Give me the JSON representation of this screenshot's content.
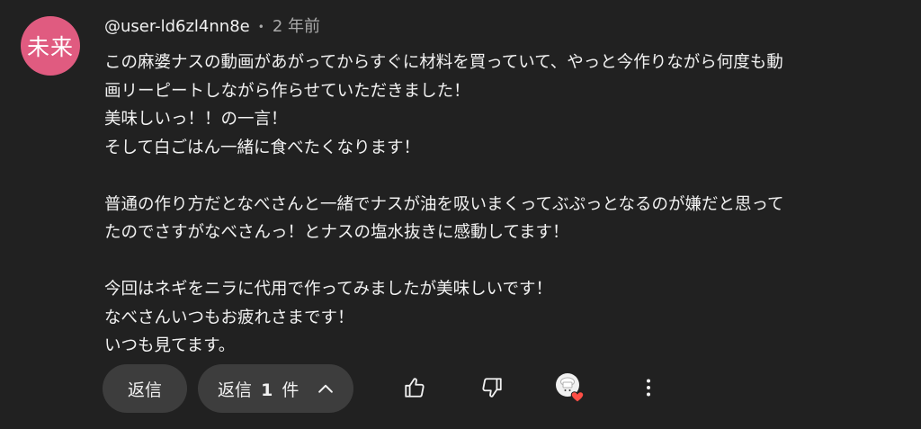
{
  "comment": {
    "avatar_text": "未来",
    "avatar_color": "#e05b80",
    "author": "@user-ld6zl4nn8e",
    "separator": "•",
    "time": "2 年前",
    "lines": [
      "この麻婆ナスの動画があがってからすぐに材料を買っていて、やっと今作りながら何度も動",
      "画リーピートしながら作らせていただきました！",
      "美味しいっ！！の一言！",
      "そして白ごはん一緒に食べたくなります！",
      "",
      "普通の作り方だとなべさんと一緒でナスが油を吸いまくってぶぷっとなるのが嫌だと思って",
      "たのでさすがなべさんっ！とナスの塩水抜きに感動してます！",
      "",
      "今回はネギをニラに代用で作ってみましたが美味しいです！",
      "なべさんいつもお疲れさまです！",
      "いつも見てます。"
    ]
  },
  "actions": {
    "reply_label": "返信",
    "replies_label_prefix": "返信",
    "replies_count": "1",
    "replies_label_suffix": "件",
    "icons": {
      "like": "thumbs-up-icon",
      "dislike": "thumbs-down-icon",
      "creator_heart": "creator-heart-icon",
      "more": "more-vertical-icon"
    },
    "heart_color": "#ff4e45"
  }
}
